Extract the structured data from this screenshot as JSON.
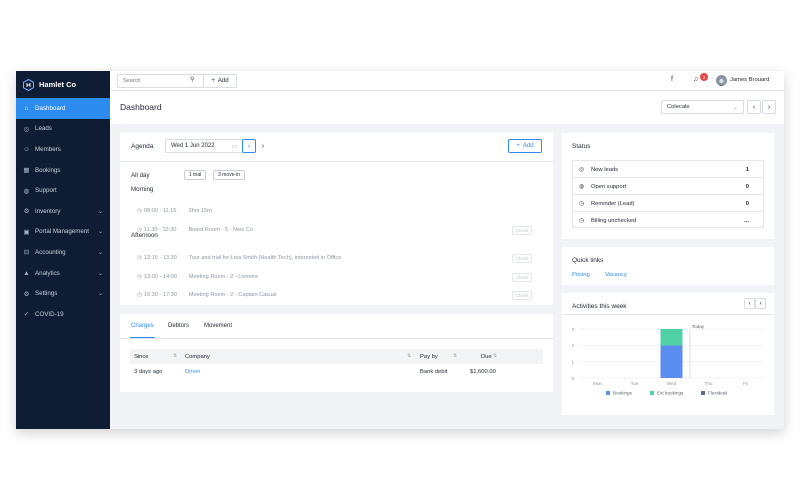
{
  "brand": {
    "name": "Hamlet Co"
  },
  "sidebar": {
    "items": [
      {
        "label": "Dashboard",
        "icon": "home-icon",
        "glyph": "⌂",
        "active": true,
        "chevron": false
      },
      {
        "label": "Leads",
        "icon": "target-icon",
        "glyph": "◎",
        "active": false,
        "chevron": false
      },
      {
        "label": "Members",
        "icon": "members-icon",
        "glyph": "☺",
        "active": false,
        "chevron": false
      },
      {
        "label": "Bookings",
        "icon": "calendar-icon",
        "glyph": "▦",
        "active": false,
        "chevron": false
      },
      {
        "label": "Support",
        "icon": "support-icon",
        "glyph": "◍",
        "active": false,
        "chevron": false
      },
      {
        "label": "Inventory",
        "icon": "gear-icon",
        "glyph": "⚙",
        "active": false,
        "chevron": true
      },
      {
        "label": "Portal Management",
        "icon": "portal-icon",
        "glyph": "▣",
        "active": false,
        "chevron": true
      },
      {
        "label": "Accounting",
        "icon": "accounting-icon",
        "glyph": "⊟",
        "active": false,
        "chevron": true
      },
      {
        "label": "Analytics",
        "icon": "analytics-icon",
        "glyph": "▲",
        "active": false,
        "chevron": true
      },
      {
        "label": "Settings",
        "icon": "settings-icon",
        "glyph": "⚙",
        "active": false,
        "chevron": true
      },
      {
        "label": "COVID-19",
        "icon": "check-icon",
        "glyph": "✓",
        "active": false,
        "chevron": false
      }
    ]
  },
  "topbar": {
    "search_placeholder": "Search",
    "add_label": "Add",
    "notification_count": "2",
    "user_name": "James Brouard"
  },
  "header": {
    "title": "Dashboard",
    "calendar_value": "Colecale"
  },
  "agenda": {
    "title": "Agenda",
    "date": "Wed 1 Jun 2022",
    "add_label": "Add",
    "all_day_label": "All day",
    "all_day_tags": [
      "1 trial",
      "3 move-in"
    ],
    "morning_label": "Morning",
    "afternoon_label": "Afternoon",
    "events": [
      {
        "time": "08:00 - 11:15",
        "detail": "3hrs 15m",
        "button": false
      },
      {
        "time": "11:30 - 12:30",
        "detail": "Board Room - 5 - New Co",
        "button": true
      },
      {
        "time": "12:15 - 13:30",
        "detail": "Tour and trial for Lisa Smith (Health Tech), interested in Office",
        "button": true
      },
      {
        "time": "13:00 - 14:00",
        "detail": "Meeting Room - 2 - Livmore",
        "button": true
      },
      {
        "time": "16:30 - 17:30",
        "detail": "Meeting Room - 2 - Captain Casual",
        "button": true
      }
    ],
    "event_button_label": "Check"
  },
  "charges": {
    "tabs": [
      "Charges",
      "Debtors",
      "Movement"
    ],
    "columns": [
      "Since",
      "Company",
      "Pay by",
      "Due"
    ],
    "rows": [
      {
        "since": "3 days ago",
        "company": "Driver",
        "pay_by": "Bank debit",
        "due": "$1,600.00"
      }
    ]
  },
  "status": {
    "title": "Status",
    "rows": [
      {
        "label": "New leads",
        "value": "1",
        "icon": "target-icon",
        "glyph": "◎"
      },
      {
        "label": "Open support",
        "value": "0",
        "icon": "support-icon",
        "glyph": "◍"
      },
      {
        "label": "Reminder (Lead)",
        "value": "0",
        "icon": "clock-icon",
        "glyph": "◷"
      },
      {
        "label": "Billing unchecked",
        "value": "...",
        "icon": "clock-icon",
        "glyph": "◷"
      }
    ]
  },
  "quick_links": {
    "title": "Quick links",
    "links": [
      "Pricing",
      "Vacancy"
    ]
  },
  "activities": {
    "title": "Activities this week",
    "today_label": "Today"
  },
  "colors": {
    "accent": "#2d8cf0",
    "sidebar_bg": "#0e1d33",
    "bookings": "#5b8def",
    "ext_bookings": "#4fd1a5",
    "flexidesk": "#5a6b8c"
  },
  "chart_data": {
    "type": "bar",
    "stacked": true,
    "categories": [
      "Mon",
      "Tue",
      "Wed",
      "Thu",
      "Fri"
    ],
    "series": [
      {
        "name": "Bookings",
        "values": [
          0,
          0,
          2,
          0,
          0
        ]
      },
      {
        "name": "Ext bookings",
        "values": [
          0,
          0,
          1,
          0,
          0
        ]
      },
      {
        "name": "Flexidesk",
        "values": [
          0,
          0,
          0,
          0,
          0
        ]
      }
    ],
    "ylim": [
      0,
      3
    ],
    "yticks": [
      0,
      1,
      2,
      3
    ],
    "legend": "bottom",
    "grid": true,
    "annotations": [
      {
        "category": "Thu",
        "label": "Today"
      }
    ]
  }
}
